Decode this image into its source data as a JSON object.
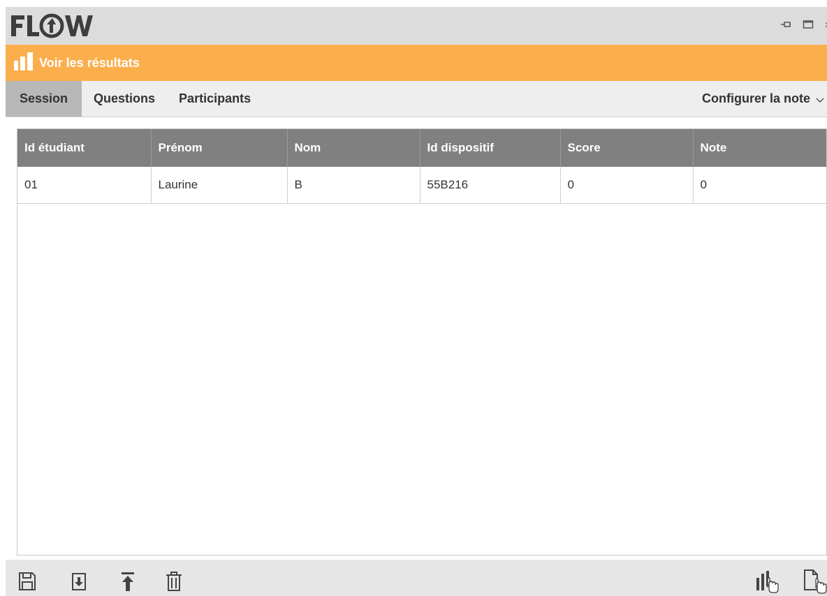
{
  "app": {
    "logo_text": "FLOW",
    "window_controls": {
      "pin_icon": "pin-icon",
      "maximize_icon": "maximize-icon",
      "close_label": "×"
    }
  },
  "banner": {
    "icon": "bar-chart-icon",
    "title": "Voir les résultats",
    "color": "#fbae4c"
  },
  "tabs": [
    {
      "label": "Session",
      "active": true
    },
    {
      "label": "Questions",
      "active": false
    },
    {
      "label": "Participants",
      "active": false
    }
  ],
  "config_menu": {
    "label": "Configurer la note",
    "icon": "chevron-down-icon"
  },
  "table": {
    "columns": [
      "Id étudiant",
      "Prénom",
      "Nom",
      "Id dispositif",
      "Score",
      "Note"
    ],
    "rows": [
      [
        "01",
        "Laurine",
        "B",
        "55B216",
        "0",
        "0"
      ]
    ]
  },
  "toolbar": {
    "left_icons": [
      "save-icon",
      "import-icon",
      "export-icon",
      "delete-icon"
    ],
    "right_icons": [
      "chart-cursor-icon",
      "document-cursor-icon"
    ]
  },
  "colors": {
    "accent": "#fbae4c",
    "header_bg": "#808080",
    "titlebar_bg": "#dcdcdc",
    "active_tab_bg": "#b8b8b8"
  }
}
